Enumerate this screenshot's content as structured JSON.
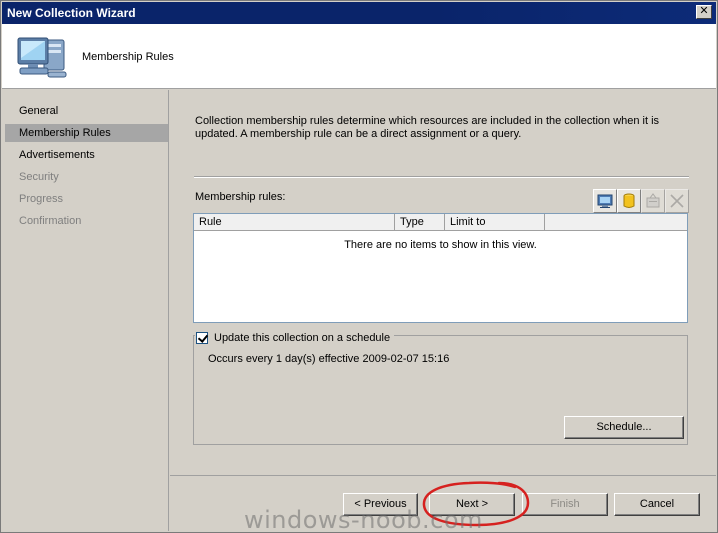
{
  "window": {
    "title": "New Collection Wizard",
    "close_glyph": "✕"
  },
  "header": {
    "title": "Membership Rules",
    "icon": "computer-monitor-icon"
  },
  "sidebar": {
    "items": [
      {
        "label": "General",
        "state": "normal"
      },
      {
        "label": "Membership Rules",
        "state": "active"
      },
      {
        "label": "Advertisements",
        "state": "normal"
      },
      {
        "label": "Security",
        "state": "disabled"
      },
      {
        "label": "Progress",
        "state": "disabled"
      },
      {
        "label": "Confirmation",
        "state": "disabled"
      }
    ]
  },
  "main": {
    "description": "Collection membership rules determine which resources are included in the collection when it is updated. A membership rule can be a direct assignment or a query.",
    "rules_label": "Membership rules:",
    "toolbar": [
      {
        "icon": "new-direct-rule-icon",
        "enabled": true
      },
      {
        "icon": "new-query-rule-icon",
        "enabled": true
      },
      {
        "icon": "properties-icon",
        "enabled": false
      },
      {
        "icon": "delete-icon",
        "enabled": false
      }
    ],
    "columns": [
      "Rule",
      "Type",
      "Limit to"
    ],
    "empty_message": "There are no items to show in this view.",
    "schedule_checkbox_label": "Update this collection on a schedule",
    "schedule_checked": true,
    "schedule_text": "Occurs every 1 day(s) effective 2009-02-07 15:16",
    "schedule_button": "Schedule..."
  },
  "footer": {
    "previous": "< Previous",
    "next": "Next >",
    "finish": "Finish",
    "cancel": "Cancel"
  },
  "watermark": "windows-noob.com",
  "colors": {
    "titlebar": "#0a246a",
    "annotation": "#d6211f",
    "active_item": "#a6a6a6"
  }
}
